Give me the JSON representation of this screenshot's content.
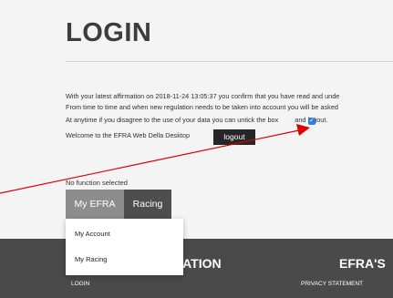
{
  "page": {
    "title": "LOGIN"
  },
  "affirmation": {
    "line1": "With your latest affirmation on 2018-11-24 13:05:37 you confirm that you have read and unde",
    "line2": "From time to time and when new regulation needs to be taken into account you will be asked",
    "line3_before_checkbox": "At anytime if you disagree to the use of your data you can untick the box",
    "line3_after_checkbox": "and logout.",
    "line4": "Welcome to the EFRA Web Della Desktop",
    "checkbox_checked": true
  },
  "logout_button": {
    "label": "logout"
  },
  "function_status": "No function selected",
  "tabs": [
    {
      "label": "My EFRA"
    },
    {
      "label": "Racing"
    }
  ],
  "dropdown": {
    "items": [
      {
        "label": "My Account"
      },
      {
        "label": "My Racing"
      }
    ]
  },
  "footer": {
    "heading_left": "RATION",
    "heading_right": "EFRA'S",
    "link_left": "LOGIN",
    "link_right": "PRIVACY STATEMENT"
  },
  "colors": {
    "page_background": "#f4f4f4",
    "footer_background": "#4a4a4a",
    "tab_active": "#8d8d8d",
    "tab_inactive": "#4e4e4e",
    "checkbox_blue": "#2f7de1",
    "annotation_arrow": "#e00000"
  },
  "icons": {
    "checkbox": "checkmark-icon"
  }
}
